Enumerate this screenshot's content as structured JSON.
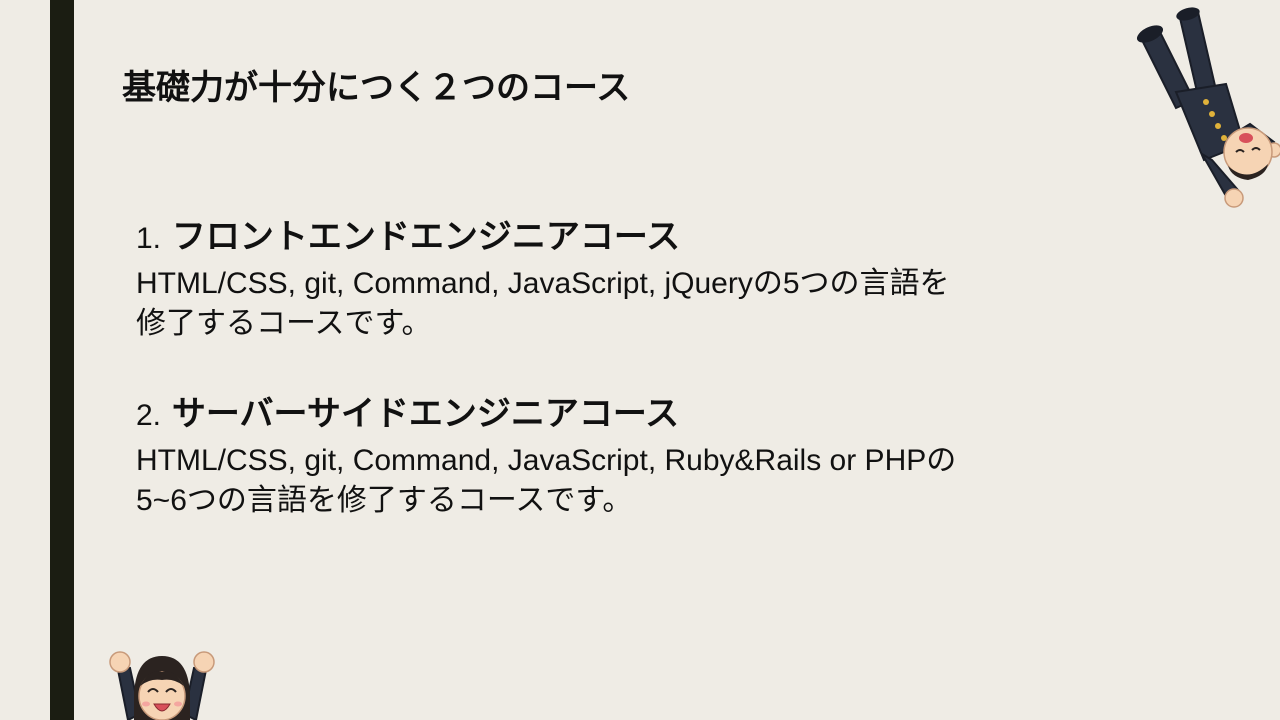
{
  "slide": {
    "title": "基礎力が十分につく２つのコース"
  },
  "courses": [
    {
      "number": "1.",
      "name": "フロントエンドエンジニアコース",
      "description_line1": "HTML/CSS, git, Command, JavaScript, jQueryの5つの言語を",
      "description_line2": "修了するコースです。"
    },
    {
      "number": "2.",
      "name": "サーバーサイドエンジニアコース",
      "description_line1": "HTML/CSS, git, Command, JavaScript, Ruby&Rails or PHPの",
      "description_line2": "5~6つの言語を修了するコースです。"
    }
  ],
  "colors": {
    "background": "#efece5",
    "accent_bar": "#1b1d12",
    "text": "#111111"
  },
  "icons": {
    "top_right": "upside-down-student-illustration",
    "bottom_left": "cheering-student-illustration"
  }
}
